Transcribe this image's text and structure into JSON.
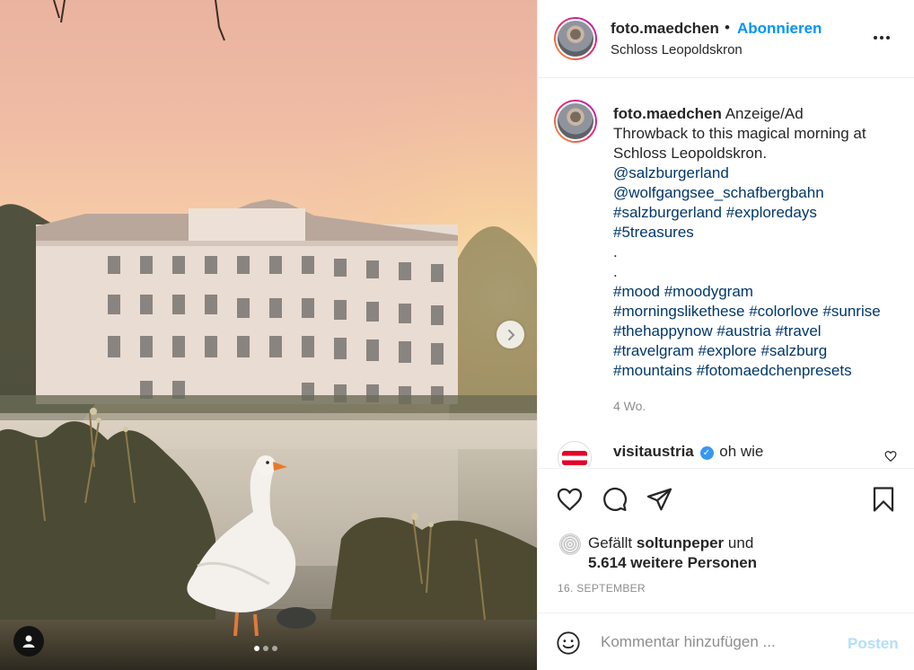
{
  "post": {
    "username": "foto.maedchen",
    "follow_label": "Abonnieren",
    "separator": "•",
    "location": "Schloss Leopoldskron"
  },
  "caption": {
    "username": "foto.maedchen",
    "label": "Anzeige/Ad",
    "text_lines": [
      "Throwback to this magical morning at",
      "Schloss Leopoldskron."
    ],
    "mentions": [
      "@salzburgerland",
      "@wolfgangsee_schafbergbahn"
    ],
    "tags_line1": [
      "#salzburgerland",
      "#exploredays"
    ],
    "tags_line2": [
      "#5treasures"
    ],
    "dots": [
      ".",
      "."
    ],
    "tags_line3": [
      "#mood",
      "#moodygram"
    ],
    "tags_line4": [
      "#morningslikethese",
      "#colorlove",
      "#sunrise"
    ],
    "tags_line5": [
      "#thehappynow",
      "#austria",
      "#travel"
    ],
    "tags_line6": [
      "#travelgram",
      "#explore",
      "#salzburg"
    ],
    "tags_line7": [
      "#mountains",
      "#fotomaedchenpresets"
    ],
    "time": "4 Wo."
  },
  "comment": {
    "username": "visitaustria",
    "verified_icon": "✓",
    "text": "oh wie"
  },
  "likes": {
    "prefix": "Gefällt",
    "user": "soltunpeper",
    "conj": "und",
    "others": "5.614 weitere Personen"
  },
  "date": "16. SEPTEMBER",
  "add_comment": {
    "placeholder": "Kommentar hinzufügen ...",
    "post_label": "Posten"
  },
  "icons": {
    "like": "heart-icon",
    "comment": "comment-icon",
    "share": "paper-plane-icon",
    "save": "bookmark-icon",
    "emoji": "smiley-icon",
    "next": "chevron-right-icon",
    "user_tag": "person-icon",
    "more": "more-dots-icon"
  },
  "colors": {
    "accent": "#0095f6",
    "hashtag": "#00376b",
    "muted": "#8e8e8e",
    "post_disabled": "#b2dffc"
  },
  "carousel": {
    "count": 3,
    "active": 1
  }
}
